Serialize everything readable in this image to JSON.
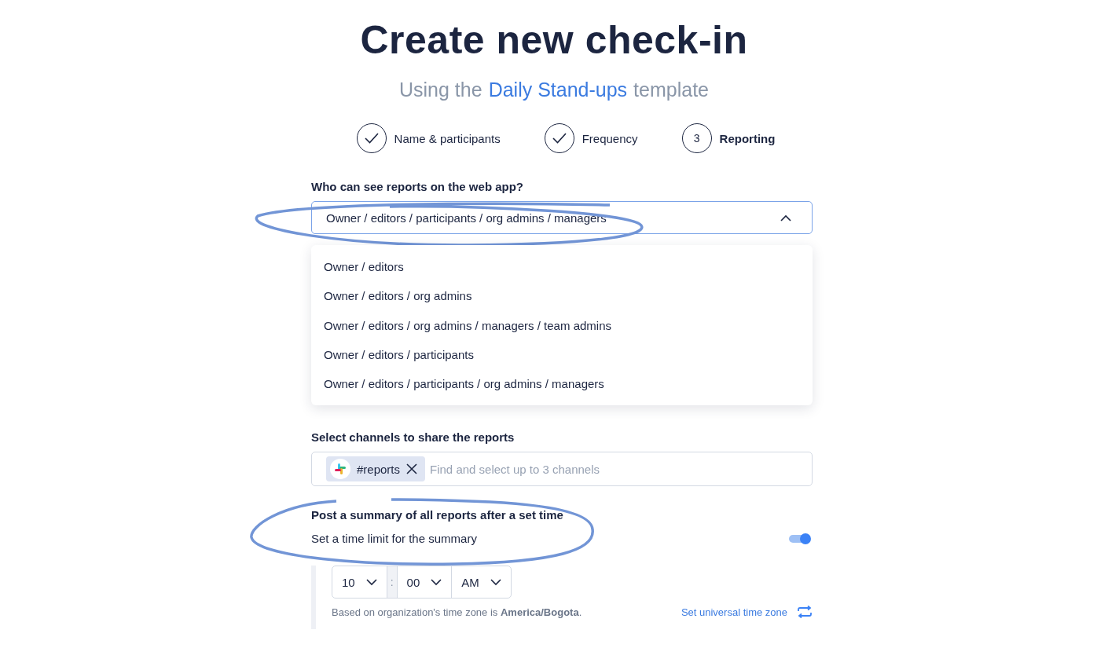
{
  "title": "Create new check-in",
  "subtitle": {
    "before": "Using the",
    "template": "Daily Stand-ups",
    "after": "template"
  },
  "steps": [
    {
      "label": "Name & participants",
      "done": true,
      "selected": false
    },
    {
      "label": "Frequency",
      "done": true,
      "selected": false
    },
    {
      "label": "Reporting",
      "done": false,
      "number": "3",
      "selected": true
    }
  ],
  "visibility": {
    "label": "Who can see reports on the web app?",
    "value": "Owner / editors / participants / org admins / managers",
    "expanded": true,
    "options": [
      {
        "label": "Owner / editors"
      },
      {
        "label": "Owner / editors / org admins"
      },
      {
        "label": "Owner / editors / org admins / managers / team admins"
      },
      {
        "label": "Owner / editors / participants"
      },
      {
        "label": "Owner / editors / participants / org admins / managers"
      }
    ]
  },
  "channels": {
    "label": "Select channels to share the reports",
    "tags": [
      {
        "label": "#reports"
      }
    ],
    "placeholder": "Find and select up to 3 channels"
  },
  "summary": {
    "title": "Post a summary of all reports after a set time",
    "subtitle": "Set a time limit for the summary",
    "on": true,
    "hour": "10",
    "separator": ":",
    "minute": "00",
    "period": "AM",
    "note": "Based on organization's time zone is **America/Bogota**.",
    "link": "Set universal time zone"
  }
}
